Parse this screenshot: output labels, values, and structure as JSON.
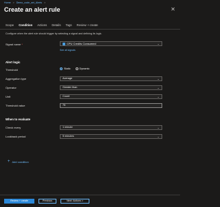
{
  "breadcrumb": [
    "Home",
    "Demo_code_wrt_Alerts"
  ],
  "page_title": "Create an alert rule",
  "tabs": [
    "Scope",
    "Condition",
    "Actions",
    "Details",
    "Tags",
    "Review + create"
  ],
  "active_tab": "Condition",
  "intro": "Configure when the alert rule should trigger by selecting a signal and defining its logic.",
  "signal": {
    "label": "Signal name",
    "required_mark": "*",
    "value": "CPU Credits Consumed",
    "link": "See all signals"
  },
  "alert_logic": {
    "heading": "Alert logic",
    "threshold": {
      "label": "Threshold",
      "options": [
        "Static",
        "Dynamic"
      ],
      "selected": "Static"
    },
    "aggregation": {
      "label": "Aggregation type",
      "value": "Average"
    },
    "operator": {
      "label": "Operator",
      "value": "Greater than"
    },
    "unit": {
      "label": "Unit",
      "value": "Count"
    },
    "threshold_value": {
      "label": "Threshold value",
      "value": "75"
    }
  },
  "evaluate": {
    "heading": "When to evaluate",
    "check_every": {
      "label": "Check every",
      "value": "1 minute"
    },
    "lookback": {
      "label": "Lookback period",
      "value": "5 minutes"
    }
  },
  "add_condition": "Add condition",
  "footer": {
    "review": "Review + create",
    "previous": "Previous",
    "next": "Next: Actions >"
  },
  "icons": {
    "close": "close-icon",
    "dropdown": "chevron-down-icon",
    "add": "plus-icon",
    "signal": "metric-icon"
  },
  "colors": {
    "accent": "#2b88d8",
    "link": "#6cb8f6",
    "background": "#1b1a19"
  }
}
